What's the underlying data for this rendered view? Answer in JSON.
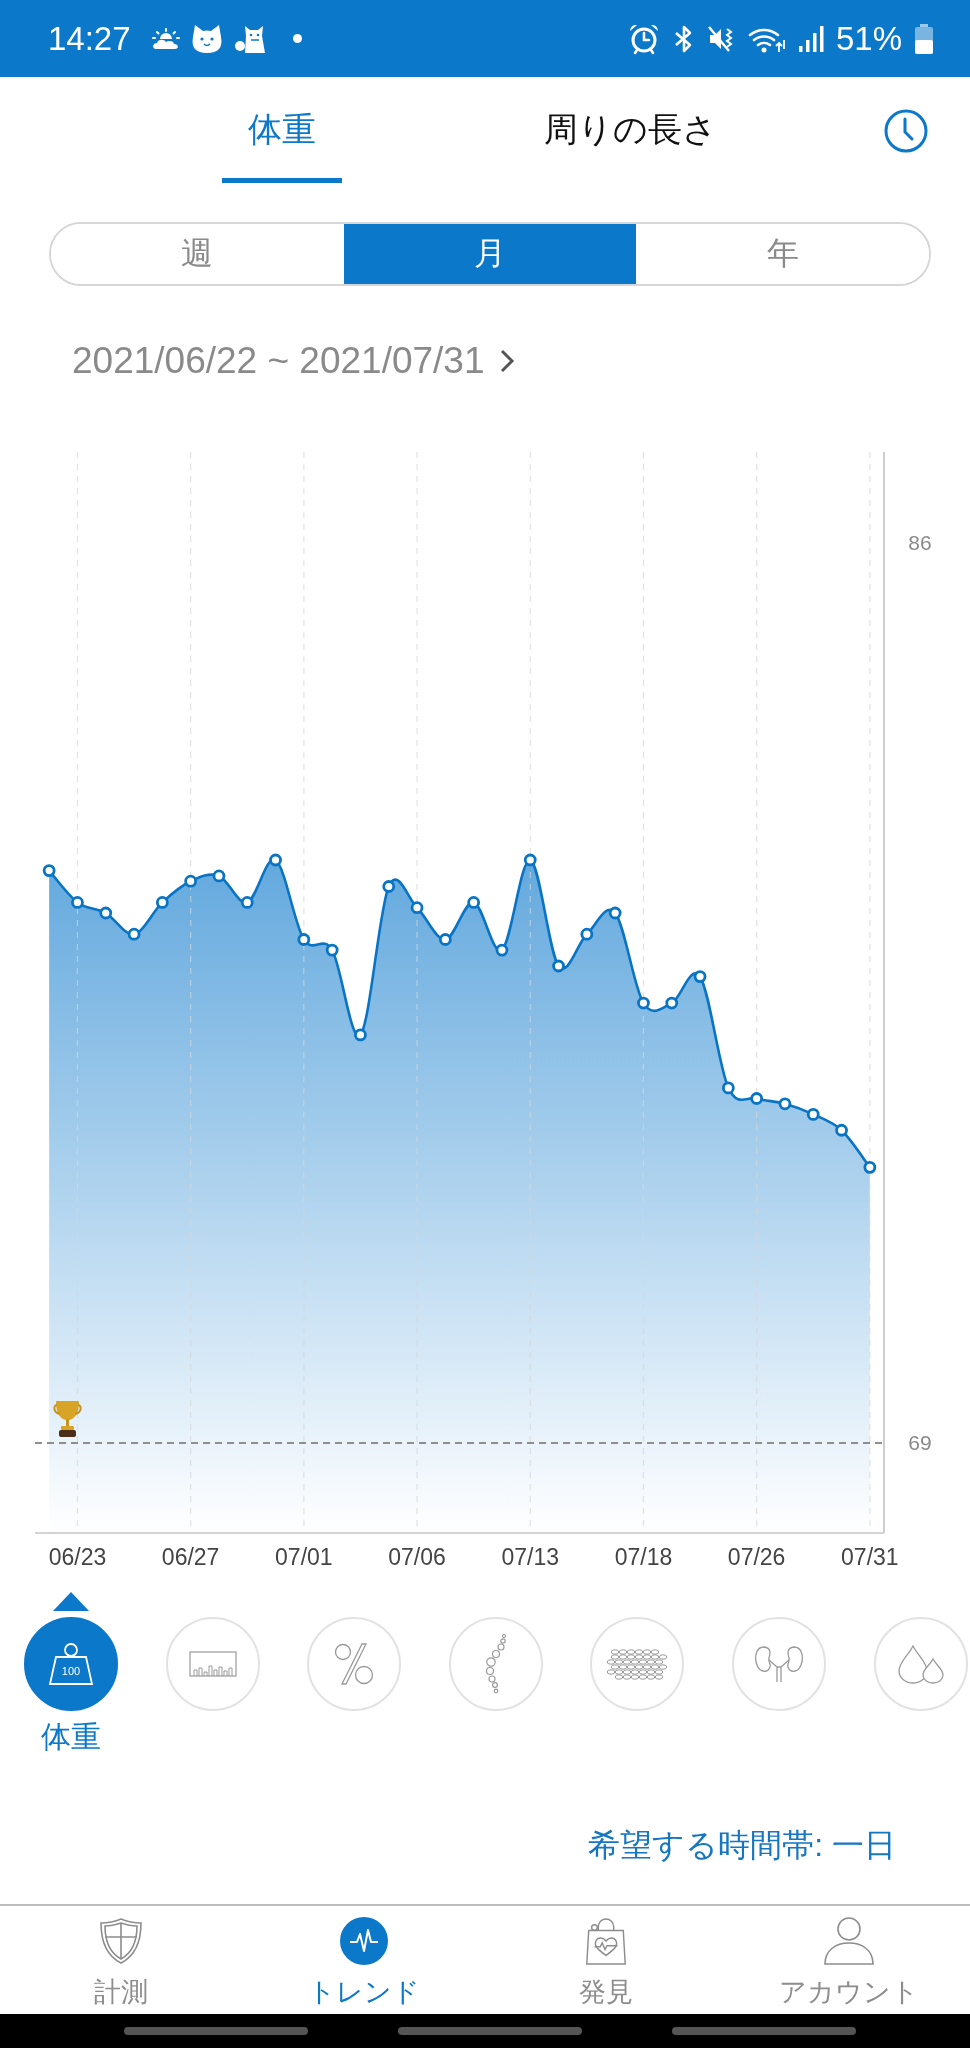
{
  "status_bar": {
    "time": "14:27",
    "battery": "51%"
  },
  "tabs": [
    {
      "label": "体重",
      "selected": true
    },
    {
      "label": "周りの長さ",
      "selected": false
    }
  ],
  "periods": [
    {
      "label": "週",
      "selected": false
    },
    {
      "label": "月",
      "selected": true
    },
    {
      "label": "年",
      "selected": false
    }
  ],
  "date_range": "2021/06/22 ~ 2021/07/31",
  "chart": {
    "chart_data": {
      "type": "area",
      "categories": [
        null,
        "06/23",
        null,
        null,
        null,
        "06/27",
        null,
        null,
        null,
        "07/01",
        null,
        null,
        null,
        "07/06",
        null,
        null,
        null,
        "07/13",
        null,
        null,
        null,
        "07/18",
        null,
        null,
        null,
        "07/26",
        null,
        null,
        null,
        "07/31"
      ],
      "series": [
        {
          "color": "#0a74c4",
          "values": [
            79.8,
            79.2,
            79.0,
            78.6,
            79.2,
            79.6,
            79.7,
            79.2,
            80.0,
            78.5,
            78.3,
            76.7,
            79.5,
            79.1,
            78.5,
            79.2,
            78.3,
            80.0,
            78.0,
            78.6,
            79.0,
            77.3,
            77.3,
            77.8,
            75.7,
            75.5,
            75.4,
            75.2,
            74.9,
            74.2
          ]
        }
      ],
      "ylim": [
        67.3,
        87.7
      ],
      "yticks": [
        69,
        86
      ],
      "grid": "x",
      "ref_lines": [
        {
          "axis": "y",
          "value": 69
        }
      ]
    }
  },
  "metrics": [
    {
      "kind": "weight",
      "selected": true,
      "label": "体重",
      "icon_text": "100"
    },
    {
      "kind": "bars",
      "selected": false
    },
    {
      "kind": "percent",
      "selected": false
    },
    {
      "kind": "spine",
      "selected": false
    },
    {
      "kind": "cells",
      "selected": false
    },
    {
      "kind": "kidneys",
      "selected": false
    },
    {
      "kind": "drops",
      "selected": false
    }
  ],
  "time_preference": "希望する時間帯: 一日",
  "bottom_nav": [
    {
      "kind": "shield",
      "label": "計測",
      "selected": false
    },
    {
      "kind": "pulse",
      "label": "トレンド",
      "selected": true
    },
    {
      "kind": "bag",
      "label": "発見",
      "selected": false
    },
    {
      "kind": "person",
      "label": "アカウント",
      "selected": false
    }
  ]
}
